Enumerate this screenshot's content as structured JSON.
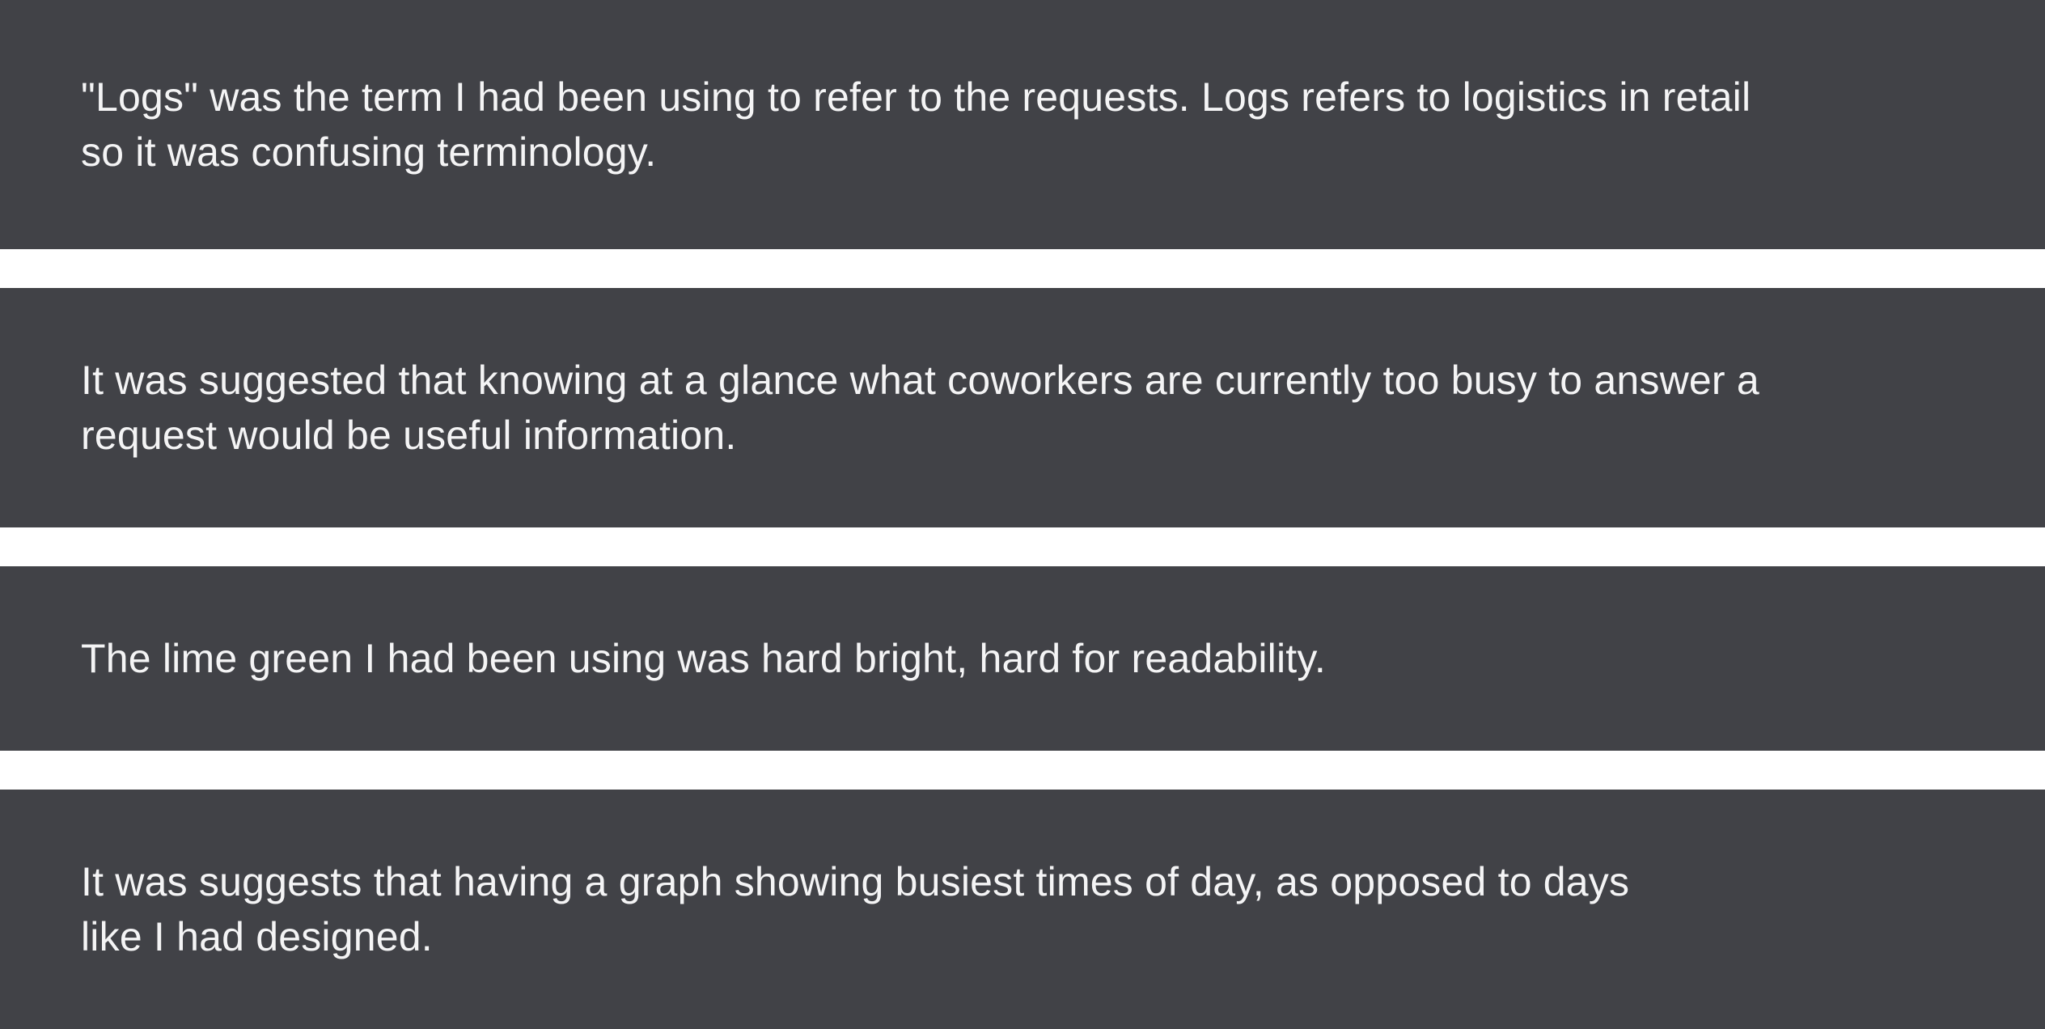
{
  "feedback": {
    "items": [
      {
        "line1": "\"Logs\" was the term I had been using to refer to the requests. Logs refers to logistics in retail",
        "line2": "so it was confusing terminology."
      },
      {
        "line1": "It was suggested that knowing at a glance what coworkers are currently too busy to answer a",
        "line2": "request would be useful information."
      },
      {
        "line1": "The lime green I had been using was hard bright, hard for readability.",
        "line2": ""
      },
      {
        "line1": "It was suggests that having a graph showing busiest times of day, as opposed to days",
        "line2": "like I had designed."
      }
    ]
  },
  "colors": {
    "card_background": "#414247",
    "card_text": "#f4f4f5",
    "page_background": "#ffffff"
  }
}
